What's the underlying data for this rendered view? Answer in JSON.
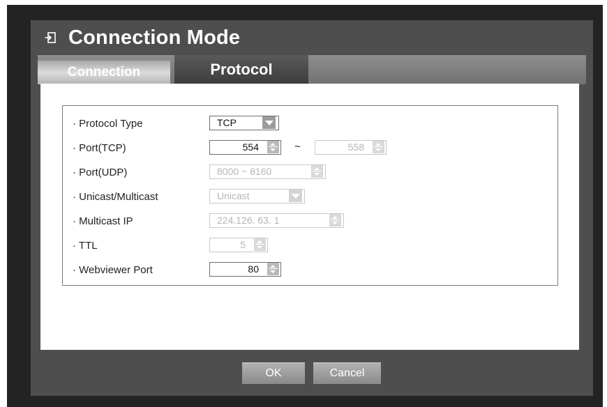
{
  "dialog": {
    "title": "Connection Mode",
    "title_icon": "exit-door-icon"
  },
  "tabs": [
    {
      "label": "Connection",
      "active": false
    },
    {
      "label": "Protocol",
      "active": true
    }
  ],
  "fields": {
    "protocol_type": {
      "label": "Protocol Type",
      "value": "TCP"
    },
    "port_tcp": {
      "label": "Port(TCP)",
      "value": "554",
      "range_separator": "~",
      "range_end": "558"
    },
    "port_udp": {
      "label": "Port(UDP)",
      "value": "8000 ~ 8160"
    },
    "unicast_multicast": {
      "label": "Unicast/Multicast",
      "value": "Unicast"
    },
    "multicast_ip": {
      "label": "Multicast IP",
      "value": "224.126. 63. 1"
    },
    "ttl": {
      "label": "TTL",
      "value": "5"
    },
    "webviewer_port": {
      "label": "Webviewer Port",
      "value": "80"
    }
  },
  "label_bullet": "·",
  "buttons": {
    "ok": "OK",
    "cancel": "Cancel"
  },
  "colors": {
    "frame": "#232323",
    "dialog": "#4e4e4e",
    "active_tab": "#474747",
    "inactive_tab": "#c8c8c8"
  }
}
